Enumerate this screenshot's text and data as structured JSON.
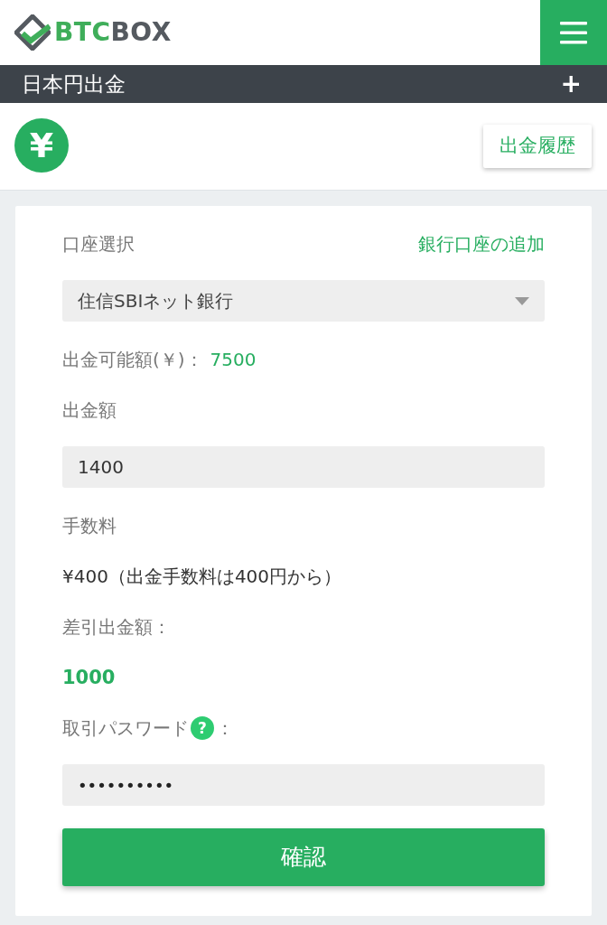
{
  "header": {
    "brand": {
      "accent_text": "BTC",
      "text": "BOX"
    }
  },
  "section_bar": {
    "title": "日本円出金",
    "toggle": "+"
  },
  "currency": {
    "symbol": "¥"
  },
  "history_button": "出金履歴",
  "form": {
    "account": {
      "label": "口座選択",
      "add_link": "銀行口座の追加",
      "select_value": "住信SBIネット銀行"
    },
    "available": {
      "label": "出金可能額(￥)：",
      "value": "7500"
    },
    "amount": {
      "label": "出金額",
      "value": "1400"
    },
    "fee": {
      "label": "手数料",
      "text": "¥400（出金手数料は400円から）"
    },
    "net": {
      "label": "差引出金額：",
      "value": "1000"
    },
    "password": {
      "label": "取引パスワード",
      "help": "?",
      "suffix": "：",
      "value": "••••••••••"
    },
    "submit": "確認"
  }
}
